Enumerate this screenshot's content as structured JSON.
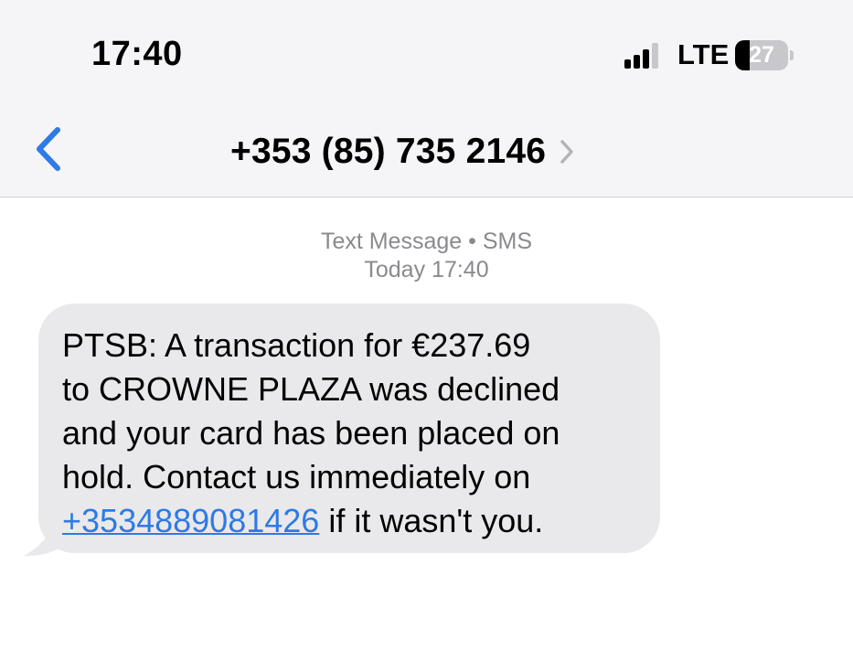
{
  "status_bar": {
    "time": "17:40",
    "network": "LTE",
    "battery_level": "27",
    "battery_fraction": 0.27,
    "signal_bars_active": 3,
    "signal_bars_total": 4
  },
  "nav": {
    "contact_number": "+353 (85) 735 2146",
    "back_icon": "chevron-left-icon",
    "detail_icon": "chevron-right-icon"
  },
  "thread": {
    "service_label": "Text Message",
    "service_separator": "•",
    "service_type": "SMS",
    "timestamp_day": "Today",
    "timestamp_time": "17:40"
  },
  "message": {
    "line1": "PTSB: A transaction for €237.69",
    "line2": "to CROWNE PLAZA was declined",
    "line3": "and your card has been placed on",
    "line4": "hold. Contact us immediately on",
    "link_number": "+3534889081426",
    "line5_rest": " if it wasn't you."
  },
  "colors": {
    "accent": "#2e7ae6",
    "header_bg": "#f5f5f7",
    "bubble_bg": "#e9e9eb",
    "meta_text": "#8a8a8e"
  }
}
